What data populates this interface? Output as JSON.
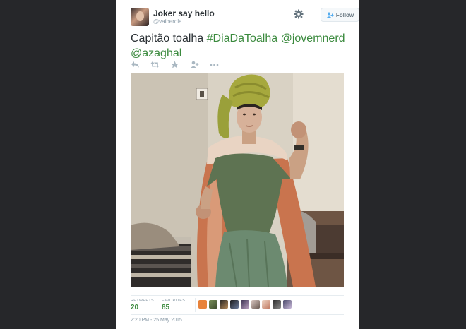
{
  "tweet": {
    "user": {
      "name": "Joker say hello",
      "handle": "@vaiberola"
    },
    "follow_label": "Follow",
    "text_plain": "Capitão toalha ",
    "hashtag": "#DiaDaToalha",
    "mention1": "@jovemnerd",
    "mention2": "@azaghal",
    "action_icons": [
      "reply-icon",
      "retweet-icon",
      "favorite-icon",
      "follow-user-icon",
      "more-icon"
    ],
    "photo_alt": "photo-capitao-toalha",
    "stats": {
      "retweets_label": "RETWEETS",
      "retweets_value": "20",
      "favorites_label": "FAVORITES",
      "favorites_value": "85"
    },
    "favorited_by_count_shown": 10,
    "timestamp": "2:20 PM - 25 May 2015"
  },
  "colors": {
    "background": "#26272a",
    "card": "#ffffff",
    "link": "#3b8a3e",
    "muted": "#8899a6",
    "text": "#292f33"
  }
}
